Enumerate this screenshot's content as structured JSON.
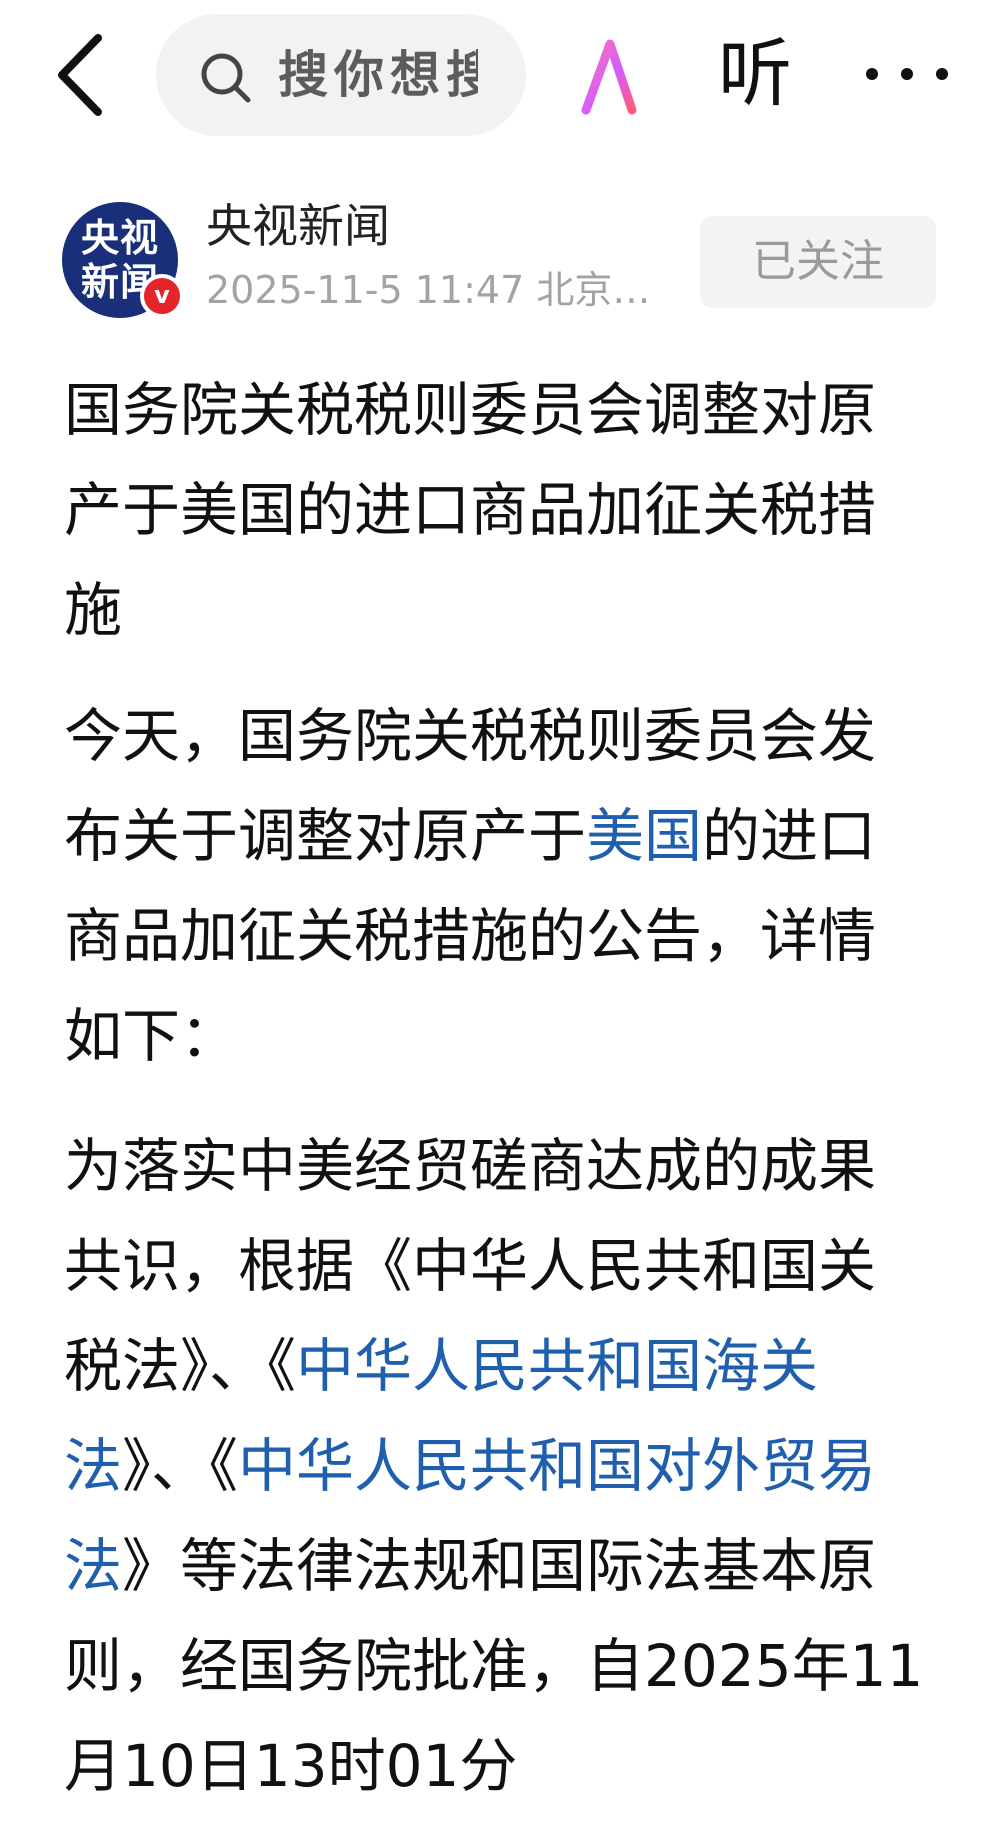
{
  "topbar": {
    "search_placeholder": "搜你想搜",
    "ai_label": "AI",
    "listen_label": "听",
    "more_label": "···"
  },
  "author": {
    "avatar_text_line1": "央视",
    "avatar_text_line2": "新闻",
    "verified_mark": "v",
    "name": "央视新闻",
    "meta": "2025-11-5  11:47  北京…",
    "follow_label": "已关注"
  },
  "article": {
    "title": "国务院关税税则委员会调整对原产于美国的进口商品加征关税措施",
    "p1": {
      "before": "今天，国务院关税税则委员会发布关于调整对原产于",
      "link": "美国",
      "after": "的进口商品加征关税措施的公告，详情如下："
    },
    "p2": {
      "part1": "为落实中美经贸磋商达成的成果共识，根据《中华人民共和国关税法》、《",
      "link1": "中华人民共和国海关法",
      "part2": "》、《",
      "link2": "中华人民共和国对外贸易法",
      "part3": "》等法律法规和国际法基本原则，经国务院批准，自2025年11月10日13时01分"
    }
  },
  "colors": {
    "link": "#1f5fae",
    "avatar_bg": "#1a2f7a",
    "verified_badge": "#e4262b",
    "follow_bg": "#f3f3f3",
    "search_bg": "#f2f2f2"
  }
}
